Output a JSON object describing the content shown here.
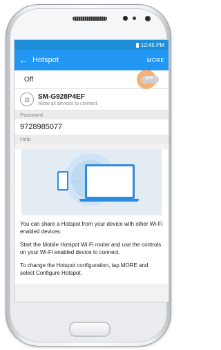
{
  "status": {
    "time": "12:45 PM"
  },
  "appbar": {
    "title": "Hotspot",
    "more_label": "MORE"
  },
  "toggle": {
    "label": "Off",
    "state_text": "OFF"
  },
  "device": {
    "name": "SM-G928P4EF",
    "subtitle": "Allow all devices to connect."
  },
  "password": {
    "header": "Password",
    "value": "9728985077"
  },
  "help": {
    "header": "Help",
    "paragraphs": [
      "You can share a Hotspot from your device with other Wi-Fi enabled devices.",
      "Start the Mobile Hotspot Wi-Fi router and use the controls on your Wi-Fi enabled device to connect.",
      "To change the Hotspot configuration, tap MORE and select Configure Hotspot."
    ]
  },
  "colors": {
    "accent": "#2196f3",
    "status_bar": "#1f8fd9",
    "toggle_highlight": "#f4954b"
  }
}
